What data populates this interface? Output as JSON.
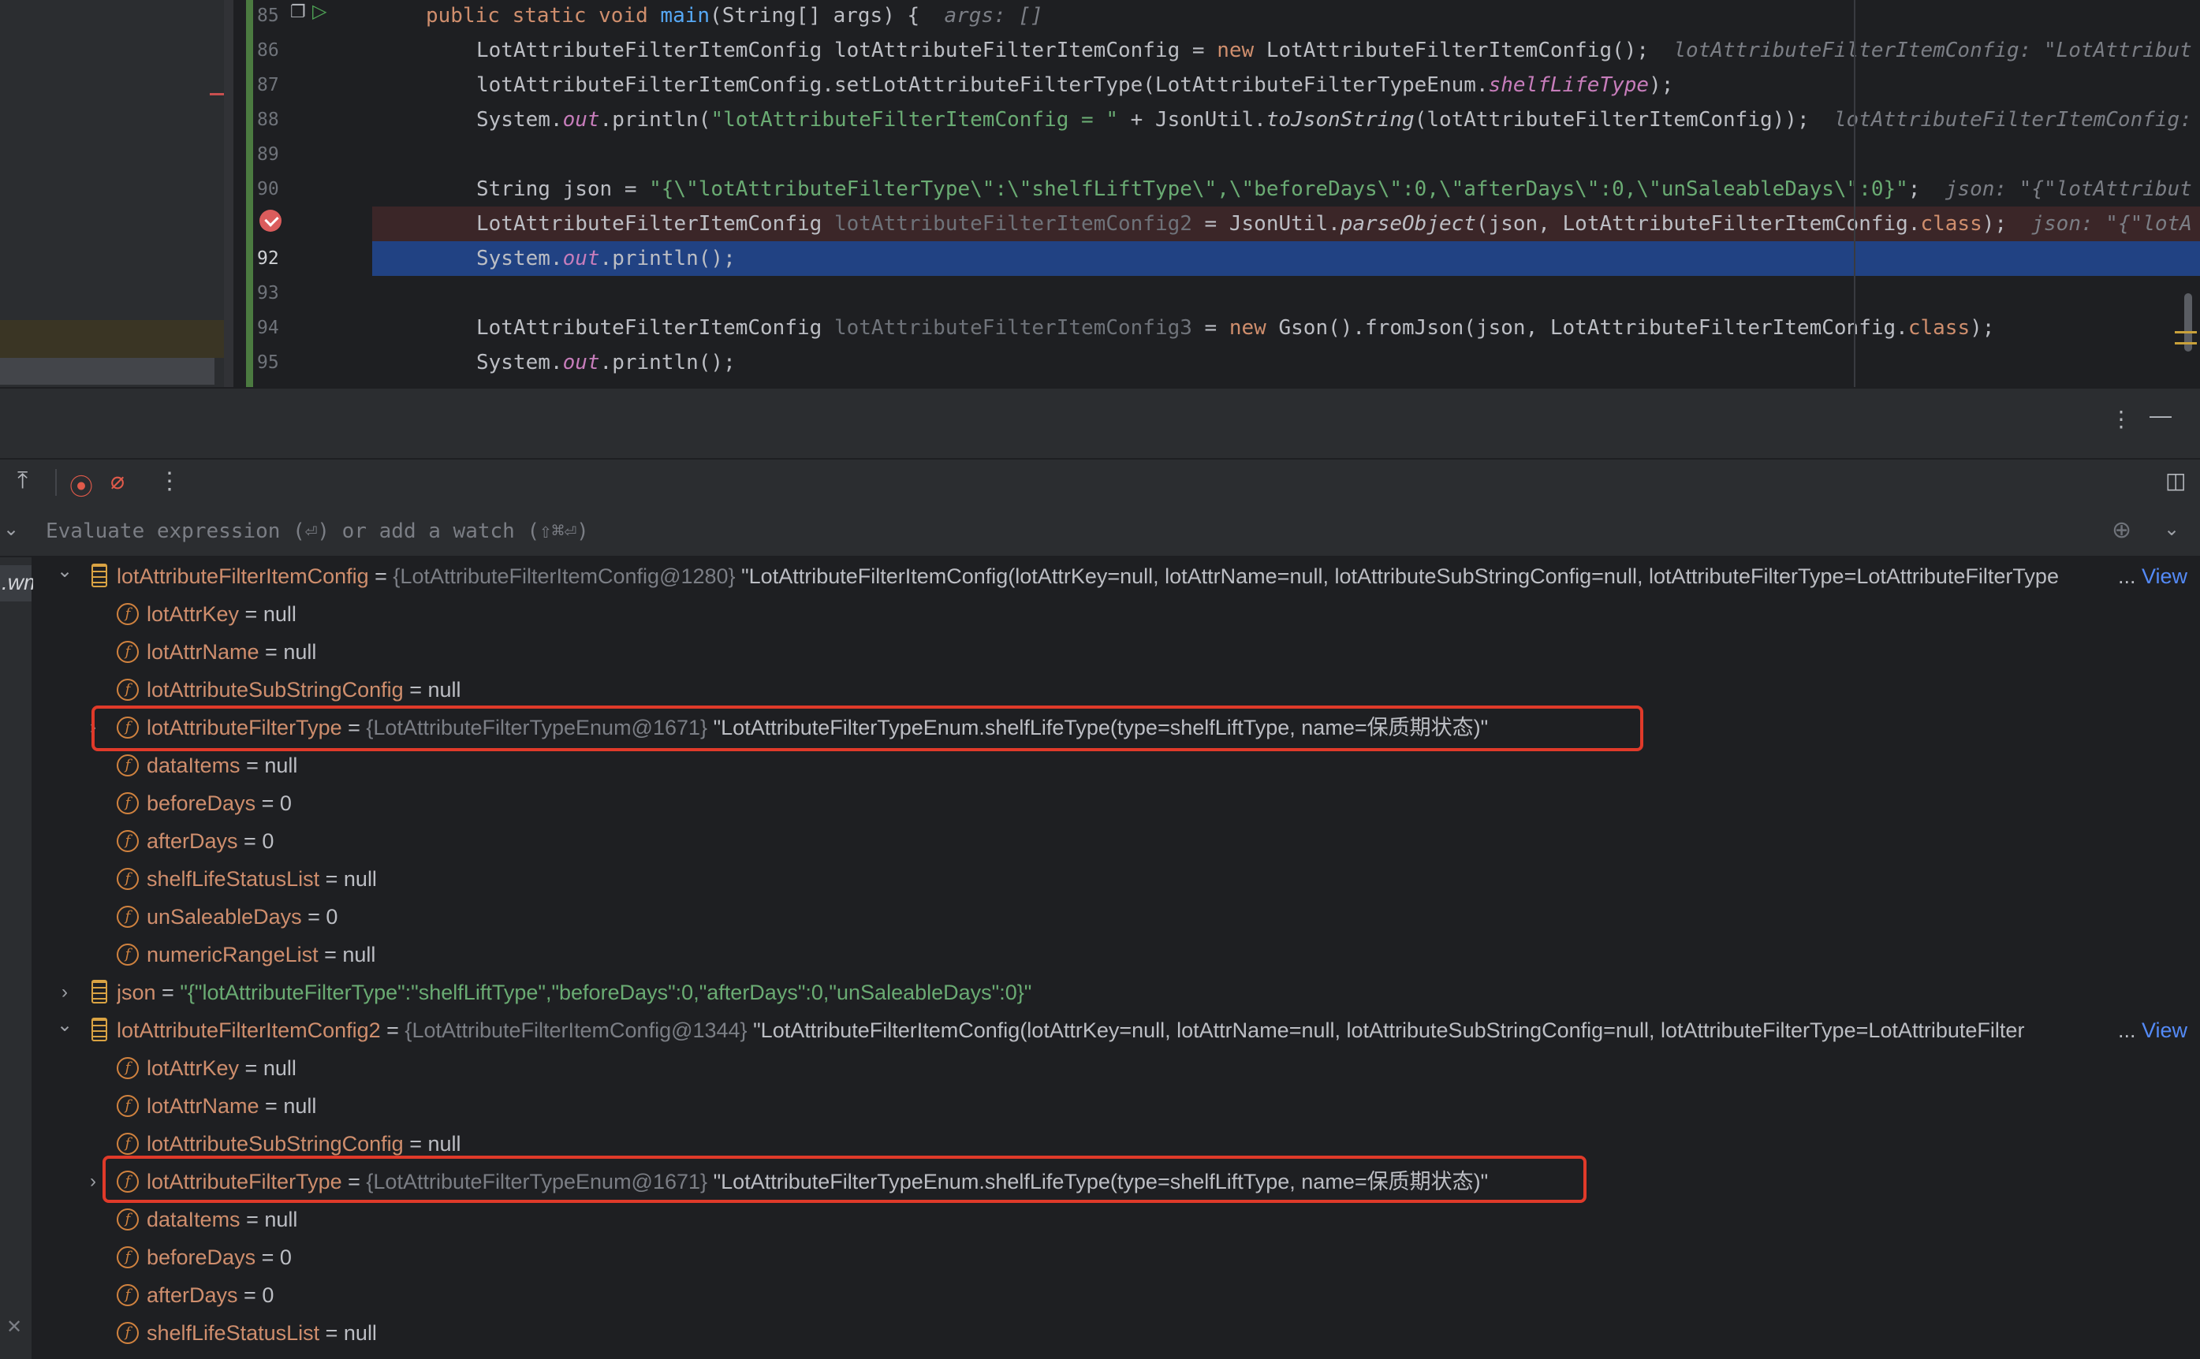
{
  "editor": {
    "lines": [
      {
        "num": "85",
        "code_html": "<span class=\"kw\">public static void</span> <span class=\"fn\">main</span>(String[] args) {  <span class=\"hint\">args: []</span>"
      },
      {
        "num": "86",
        "code_html": "LotAttributeFilterItemConfig lotAttributeFilterItemConfig = <span class=\"kw\">new</span> LotAttributeFilterItemConfig();  <span class=\"hint\">lotAttributeFilterItemConfig: \"LotAttribut</span>"
      },
      {
        "num": "87",
        "code_html": "lotAttributeFilterItemConfig.setLotAttributeFilterType(LotAttributeFilterTypeEnum.<span class=\"fld\">shelfLifeType</span>);"
      },
      {
        "num": "88",
        "code_html": "System.<span class=\"fld\">out</span>.println(<span class=\"str\">\"lotAttributeFilterItemConfig = \"</span> + JsonUtil.<span class=\"stat\">toJsonString</span>(lotAttributeFilterItemConfig));  <span class=\"hint\">lotAttributeFilterItemConfig:</span>"
      },
      {
        "num": "89",
        "code_html": ""
      },
      {
        "num": "90",
        "code_html": "String json = <span class=\"str\">\"{\\\"lotAttributeFilterType\\\":\\\"shelfLiftType\\\",\\\"beforeDays\\\":0,\\\"afterDays\\\":0,\\\"unSaleableDays\\\":0}\"</span>;  <span class=\"hint\">json: \"{\"lotAttribut</span>"
      },
      {
        "num": "",
        "code_html": "LotAttributeFilterItemConfig <span class=\"gray\">lotAttributeFilterItemConfig2</span> = JsonUtil.<span class=\"stat\">parseObject</span>(json, LotAttributeFilterItemConfig.<span class=\"kw\">class</span>);  <span class=\"hint\">json: \"{\"lotA</span>"
      },
      {
        "num": "92",
        "code_html": "System.<span class=\"fld\">out</span>.println();"
      },
      {
        "num": "93",
        "code_html": ""
      },
      {
        "num": "94",
        "code_html": "LotAttributeFilterItemConfig <span class=\"gray\">lotAttributeFilterItemConfig3</span> = <span class=\"kw\">new</span> Gson().fromJson(json, LotAttributeFilterItemConfig.<span class=\"kw\">class</span>);"
      },
      {
        "num": "95",
        "code_html": "System.<span class=\"fld\">out</span>.println();"
      }
    ]
  },
  "debug": {
    "eval_placeholder": "Evaluate expression (⏎) or add a watch (⇧⌘⏎)",
    "frame_label": ".wm",
    "view_label": "View",
    "variables": [
      {
        "kind": "local",
        "expanded": true,
        "name": "lotAttributeFilterItemConfig",
        "ref": "{LotAttributeFilterItemConfig@1280}",
        "value": "\"LotAttributeFilterItemConfig(lotAttrKey=null, lotAttrName=null, lotAttributeSubStringConfig=null, lotAttributeFilterType=LotAttributeFilterType",
        "ellipsis": "...",
        "view": true
      },
      {
        "kind": "field",
        "name": "lotAttrKey",
        "value": "null"
      },
      {
        "kind": "field",
        "name": "lotAttrName",
        "value": "null"
      },
      {
        "kind": "field",
        "name": "lotAttributeSubStringConfig",
        "value": "null"
      },
      {
        "kind": "field",
        "expandable": true,
        "name": "lotAttributeFilterType",
        "ref": "{LotAttributeFilterTypeEnum@1671}",
        "value": "\"LotAttributeFilterTypeEnum.shelfLifeType(type=shelfLiftType, name=保质期状态)\""
      },
      {
        "kind": "field",
        "name": "dataItems",
        "value": "null"
      },
      {
        "kind": "field",
        "name": "beforeDays",
        "value": "0"
      },
      {
        "kind": "field",
        "name": "afterDays",
        "value": "0"
      },
      {
        "kind": "field",
        "name": "shelfLifeStatusList",
        "value": "null"
      },
      {
        "kind": "field",
        "name": "unSaleableDays",
        "value": "0"
      },
      {
        "kind": "field",
        "name": "numericRangeList",
        "value": "null"
      },
      {
        "kind": "local",
        "expanded": false,
        "name": "json",
        "value": "\"{\"lotAttributeFilterType\":\"shelfLiftType\",\"beforeDays\":0,\"afterDays\":0,\"unSaleableDays\":0}\"",
        "green": true
      },
      {
        "kind": "local",
        "expanded": true,
        "name": "lotAttributeFilterItemConfig2",
        "ref": "{LotAttributeFilterItemConfig@1344}",
        "value": "\"LotAttributeFilterItemConfig(lotAttrKey=null, lotAttrName=null, lotAttributeSubStringConfig=null, lotAttributeFilterType=LotAttributeFilter",
        "ellipsis": "...",
        "view": true
      },
      {
        "kind": "field",
        "name": "lotAttrKey",
        "value": "null"
      },
      {
        "kind": "field",
        "name": "lotAttrName",
        "value": "null"
      },
      {
        "kind": "field",
        "name": "lotAttributeSubStringConfig",
        "value": "null"
      },
      {
        "kind": "field",
        "expandable": true,
        "name": "lotAttributeFilterType",
        "ref": "{LotAttributeFilterTypeEnum@1671}",
        "value": "\"LotAttributeFilterTypeEnum.shelfLifeType(type=shelfLiftType, name=保质期状态)\""
      },
      {
        "kind": "field",
        "name": "dataItems",
        "value": "null"
      },
      {
        "kind": "field",
        "name": "beforeDays",
        "value": "0"
      },
      {
        "kind": "field",
        "name": "afterDays",
        "value": "0"
      },
      {
        "kind": "field",
        "name": "shelfLifeStatusList",
        "value": "null"
      }
    ]
  },
  "colors": {
    "highlight_box": "#e03a2a",
    "current_line": "#214283",
    "breakpoint": "#db5c5c"
  }
}
